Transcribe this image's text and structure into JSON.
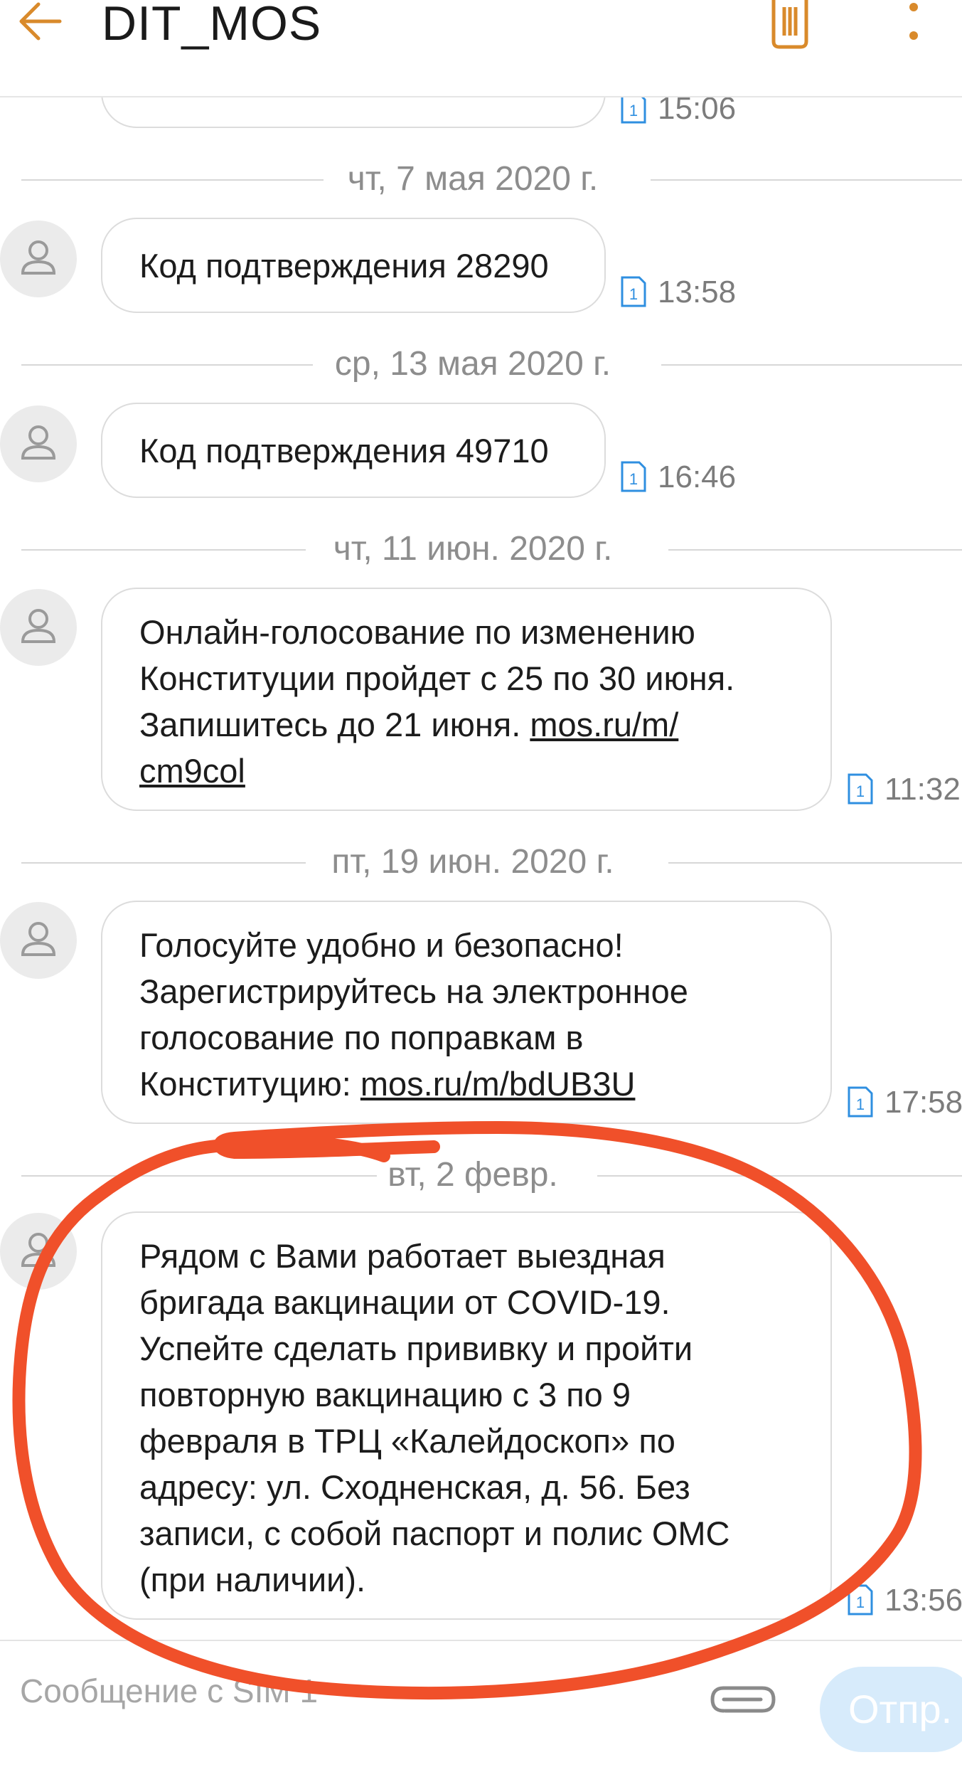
{
  "header": {
    "back_icon": "arrow-left-icon",
    "title": "DIT_MOS",
    "delete_icon": "trash-icon",
    "more_icon": "more-vertical-icon",
    "accent_color": "#D98A2B"
  },
  "messages": [
    {
      "date": "",
      "text": "",
      "time": "15:06",
      "sim": "1"
    },
    {
      "date": "чт, 7 мая 2020 г.",
      "text": "Код подтверждения 28290",
      "time": "13:58",
      "sim": "1"
    },
    {
      "date": "ср, 13 мая 2020 г.",
      "text": "Код подтверждения 49710",
      "time": "16:46",
      "sim": "1"
    },
    {
      "date": "чт, 11 июн. 2020 г.",
      "text_before_link": "Онлайн-голосование по изменению\nКонституции пройдет с 25 по 30 июня.\nЗапишитесь до 21 июня. ",
      "link": "mos.ru/m/\ncm9col",
      "time": "11:32",
      "sim": "1"
    },
    {
      "date": "пт, 19 июн. 2020 г.",
      "text_before_link": "Голосуйте удобно и безопасно!\nЗарегистрируйтесь на электронное\nголосование по поправкам в\nКонституцию: ",
      "link": "mos.ru/m/bdUB3U",
      "time": "17:58",
      "sim": "1"
    },
    {
      "date": "вт, 2 февр.",
      "text": "Рядом с Вами работает выездная\nбригада вакцинации от COVID-19.\nУспейте сделать прививку и пройти\nповторную вакцинацию с 3 по 9\nфевраля в ТРЦ «Калейдоскоп» по\nадресу: ул. Сходненская, д. 56. Без\nзаписи, с собой паспорт и полис ОМС\n(при наличии).",
      "time": "13:56",
      "sim": "1"
    }
  ],
  "compose": {
    "placeholder": "Сообщение с SIM 1",
    "attach_icon": "paperclip-icon",
    "send_label": "Отпр."
  },
  "annotation_color": "#F0502A"
}
